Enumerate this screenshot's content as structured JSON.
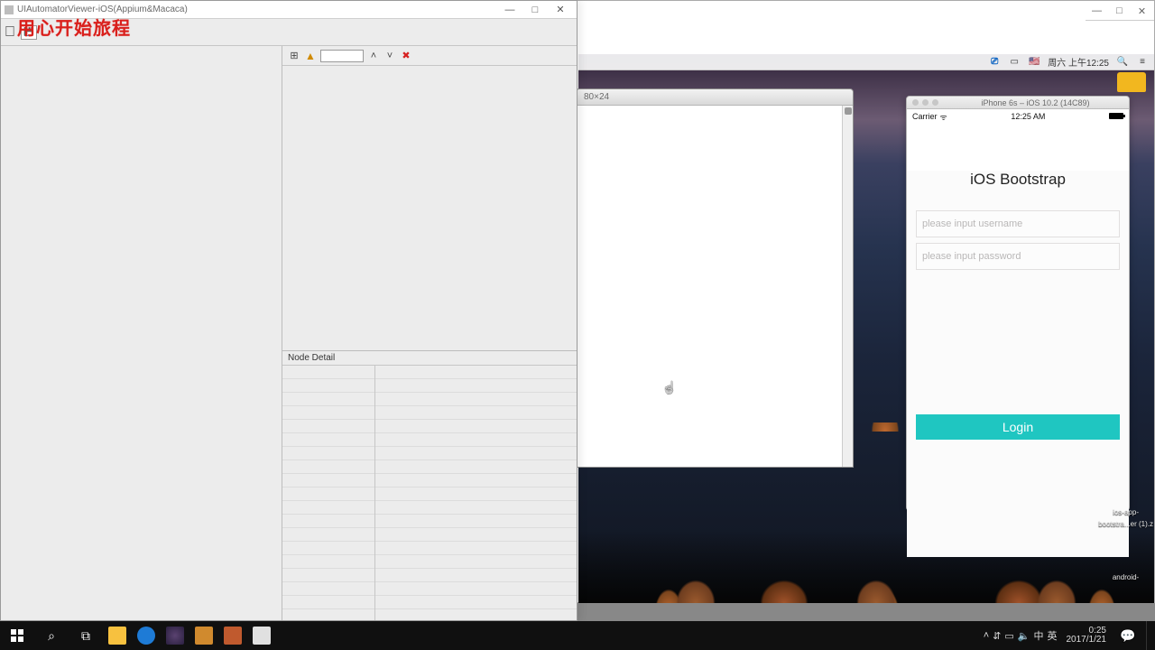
{
  "remote_window": {
    "min": "—",
    "max": "□",
    "close": "✕"
  },
  "mac_menubar": {
    "teamviewer_icon": "tv",
    "screen_icon": "⧉",
    "flag": "🇺🇸",
    "datetime": "周六 上午12:25",
    "search_icon": "🔍",
    "menu_icon": "≡"
  },
  "terminal": {
    "title": "80×24"
  },
  "simulator": {
    "chrome_label": "iPhone 6s – iOS 10.2 (14C89)",
    "carrier": "Carrier",
    "wifi": "ᯤ",
    "clock": "12:25 AM",
    "app_title": "iOS Bootstrap",
    "username_placeholder": "please input username",
    "password_placeholder": "please input password",
    "login_label": "Login"
  },
  "mac_labels": {
    "ios_app": "ios-app-",
    "ios_app2": "bootstra...er (1).z",
    "android": "android-"
  },
  "inspector": {
    "title": "UIAutomatorViewer-iOS(Appium&Macaca)",
    "win_min": "—",
    "win_max": "□",
    "win_close": "✕",
    "overlay": "用心开始旅程",
    "node_detail_label": "Node Detail",
    "tree_search_value": ""
  },
  "taskbar": {
    "time": "0:25",
    "date": "2017/1/21",
    "ime1": "中",
    "ime2": "英"
  }
}
